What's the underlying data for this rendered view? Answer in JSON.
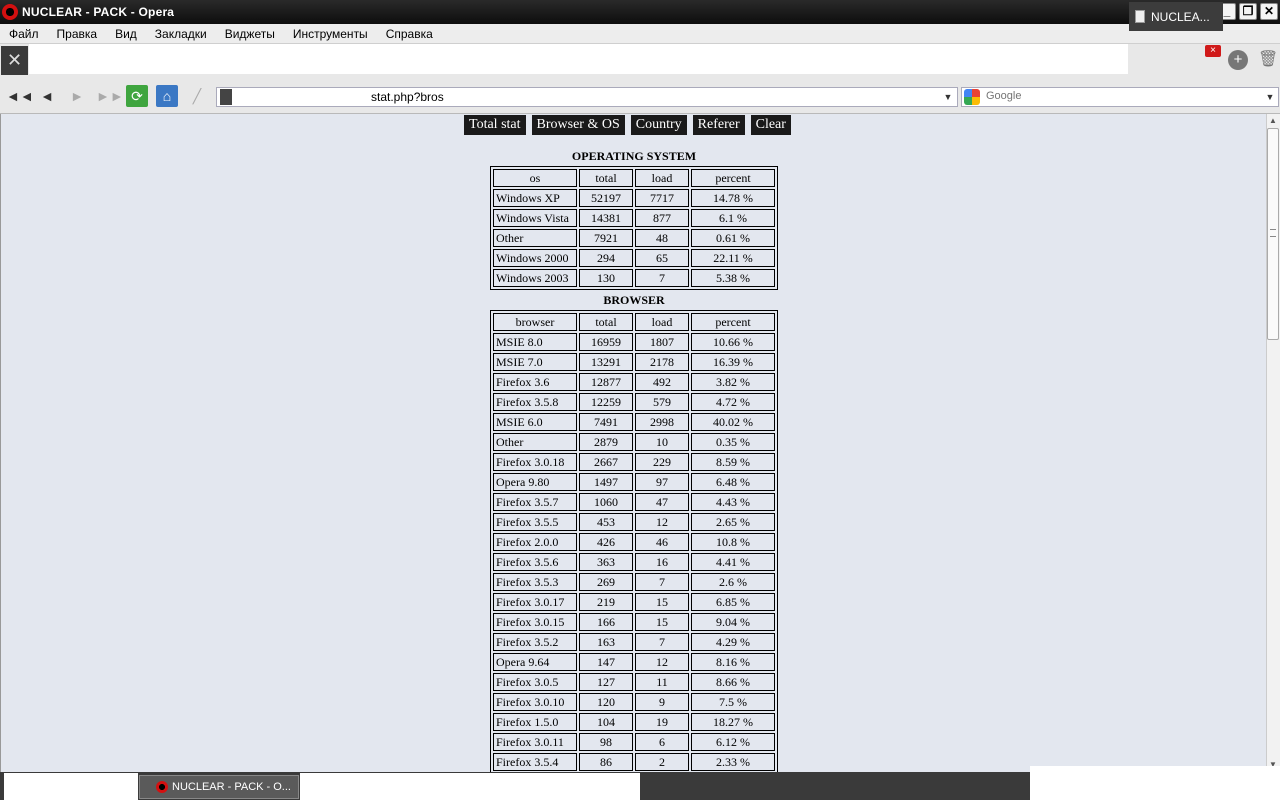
{
  "window": {
    "title": "NUCLEAR - PACK - Opera"
  },
  "menu": {
    "items": [
      "Файл",
      "Правка",
      "Вид",
      "Закладки",
      "Виджеты",
      "Инструменты",
      "Справка"
    ]
  },
  "tab": {
    "label": "NUCLEA..."
  },
  "address": {
    "url": "stat.php?bros"
  },
  "search": {
    "placeholder": "Google"
  },
  "nav_links": [
    "Total stat",
    "Browser & OS",
    "Country",
    "Referer",
    "Clear"
  ],
  "os_section": {
    "title": "OPERATING SYSTEM",
    "headers": [
      "os",
      "total",
      "load",
      "percent"
    ],
    "rows": [
      [
        "Windows XP",
        "52197",
        "7717",
        "14.78 %"
      ],
      [
        "Windows Vista",
        "14381",
        "877",
        "6.1 %"
      ],
      [
        "Other",
        "7921",
        "48",
        "0.61 %"
      ],
      [
        "Windows 2000",
        "294",
        "65",
        "22.11 %"
      ],
      [
        "Windows 2003",
        "130",
        "7",
        "5.38 %"
      ]
    ]
  },
  "browser_section": {
    "title": "BROWSER",
    "headers": [
      "browser",
      "total",
      "load",
      "percent"
    ],
    "rows": [
      [
        "MSIE 8.0",
        "16959",
        "1807",
        "10.66 %"
      ],
      [
        "MSIE 7.0",
        "13291",
        "2178",
        "16.39 %"
      ],
      [
        "Firefox 3.6",
        "12877",
        "492",
        "3.82 %"
      ],
      [
        "Firefox 3.5.8",
        "12259",
        "579",
        "4.72 %"
      ],
      [
        "MSIE 6.0",
        "7491",
        "2998",
        "40.02 %"
      ],
      [
        "Other",
        "2879",
        "10",
        "0.35 %"
      ],
      [
        "Firefox 3.0.18",
        "2667",
        "229",
        "8.59 %"
      ],
      [
        "Opera 9.80",
        "1497",
        "97",
        "6.48 %"
      ],
      [
        "Firefox 3.5.7",
        "1060",
        "47",
        "4.43 %"
      ],
      [
        "Firefox 3.5.5",
        "453",
        "12",
        "2.65 %"
      ],
      [
        "Firefox 2.0.0",
        "426",
        "46",
        "10.8 %"
      ],
      [
        "Firefox 3.5.6",
        "363",
        "16",
        "4.41 %"
      ],
      [
        "Firefox 3.5.3",
        "269",
        "7",
        "2.6 %"
      ],
      [
        "Firefox 3.0.17",
        "219",
        "15",
        "6.85 %"
      ],
      [
        "Firefox 3.0.15",
        "166",
        "15",
        "9.04 %"
      ],
      [
        "Firefox 3.5.2",
        "163",
        "7",
        "4.29 %"
      ],
      [
        "Opera 9.64",
        "147",
        "12",
        "8.16 %"
      ],
      [
        "Firefox 3.0.5",
        "127",
        "11",
        "8.66 %"
      ],
      [
        "Firefox 3.0.10",
        "120",
        "9",
        "7.5 %"
      ],
      [
        "Firefox 1.5.0",
        "104",
        "19",
        "18.27 %"
      ],
      [
        "Firefox 3.0.11",
        "98",
        "6",
        "6.12 %"
      ],
      [
        "Firefox 3.5.4",
        "86",
        "2",
        "2.33 %"
      ]
    ]
  },
  "taskbar": {
    "task_label": "NUCLEAR - PACK - O..."
  },
  "icons": {
    "back_fast": "◄◄",
    "back": "◄",
    "forward": "►",
    "forward_fast": "►►",
    "reload": "⟳",
    "home": "⌂",
    "edit": "╱",
    "tools": "✕",
    "newtab": "+",
    "trash": "🗑",
    "close": "×",
    "dropdown": "▼",
    "scroll_up": "▲",
    "scroll_down": "▼"
  }
}
